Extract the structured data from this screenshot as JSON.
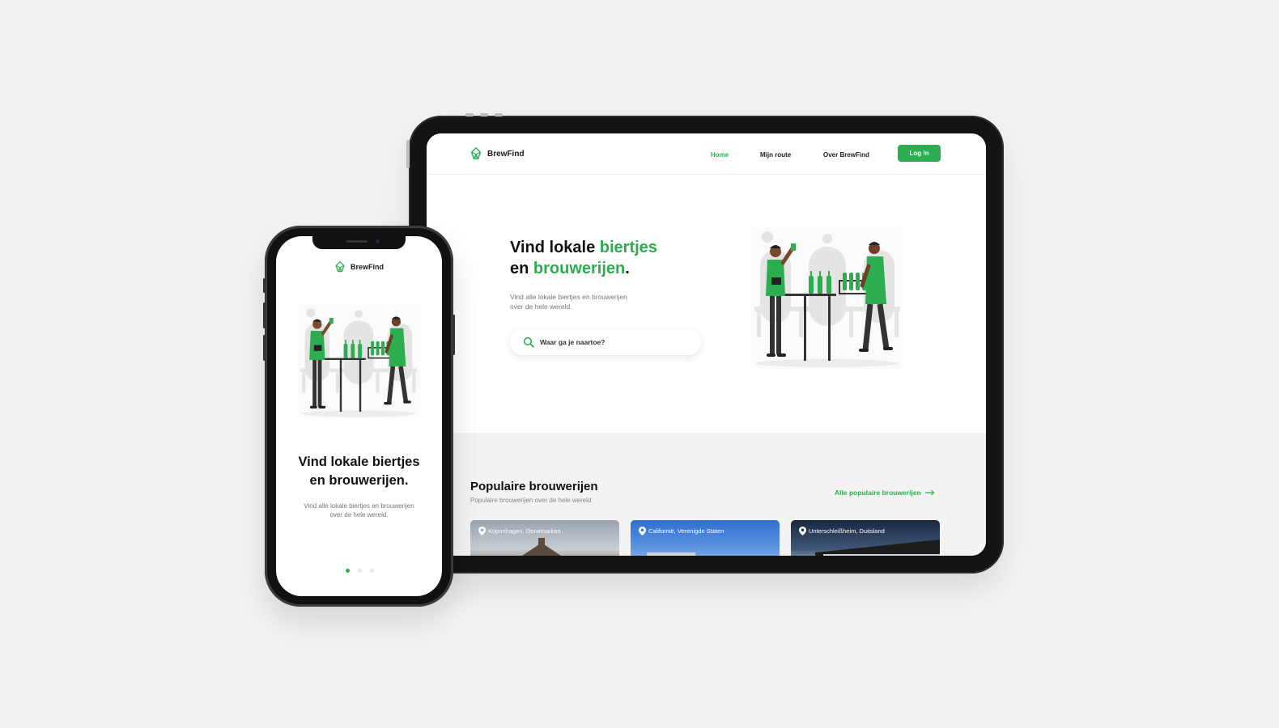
{
  "brand": {
    "name": "BrewFind",
    "accent": "#2cad50"
  },
  "tablet": {
    "nav": {
      "links": [
        "Home",
        "Mijn route",
        "Over BrewFind"
      ],
      "active": "Home",
      "login": "Log in"
    },
    "hero": {
      "title_part1": "Vind lokale ",
      "title_green1": "biertjes",
      "title_part2": "en ",
      "title_green2": "brouwerijen",
      "title_end": ".",
      "subtitle_line1": "Vind alle lokale biertjes en brouwerijen",
      "subtitle_line2": "over de hele wereld.",
      "search_placeholder": "Waar ga je naartoe?"
    },
    "popular": {
      "title": "Populaire brouwerijen",
      "subtitle": "Populaire brouwerijen over de hele wereld",
      "link": "Alle populaire brouwerijen",
      "cards": [
        {
          "location": "Kopenhagen, Denemarken"
        },
        {
          "location": "Californië, Verenigde Staten"
        },
        {
          "location": "Unterschleißheim, Duitsland"
        }
      ]
    }
  },
  "phone": {
    "title_line1": "Vind lokale biertjes",
    "title_line2": "en brouwerijen.",
    "subtitle_line1": "Vind alle lokale biertjes en brouwerijen",
    "subtitle_line2": "over de hele wereld.",
    "carousel_pages": 3,
    "carousel_active": 1
  }
}
